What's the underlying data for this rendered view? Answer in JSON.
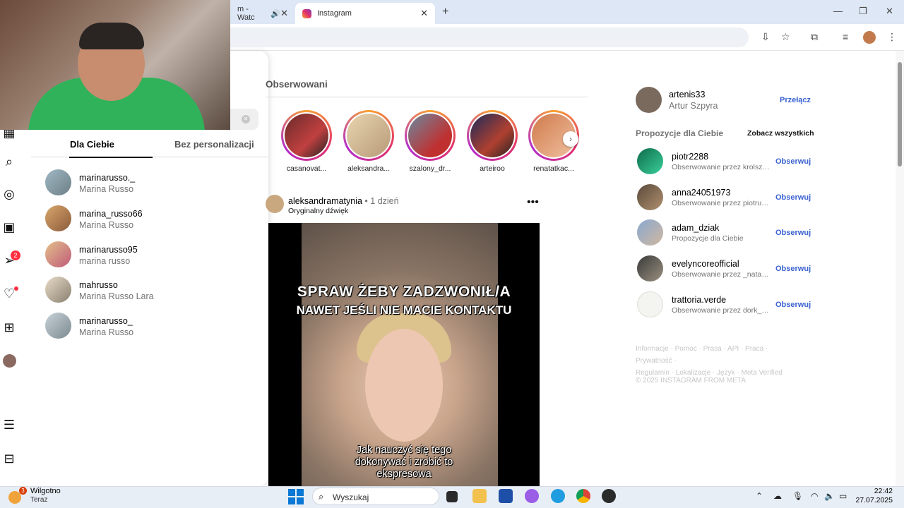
{
  "browser": {
    "tab_prev_title": "m - Watc",
    "tab_active_title": "Instagram",
    "new_tab": "+",
    "close": "✕"
  },
  "search_panel": {
    "tabs": [
      {
        "label": "Dla Ciebie",
        "active": true
      },
      {
        "label": "Bez personalizacji",
        "active": false
      }
    ],
    "results": [
      {
        "username": "marinarusso._",
        "name": "Marina Russo"
      },
      {
        "username": "marina_russo66",
        "name": "Marina Russo"
      },
      {
        "username": "marinarusso95",
        "name": "marina russo"
      },
      {
        "username": "mahrusso",
        "name": "Marina Russo Lara"
      },
      {
        "username": "marinarusso_",
        "name": "Marina Russo"
      }
    ]
  },
  "nav": {
    "messages_badge": "2"
  },
  "feed": {
    "section_title": "Obserwowani",
    "stories": [
      {
        "label": "casanovat..."
      },
      {
        "label": "aleksandra..."
      },
      {
        "label": "szalony_dr..."
      },
      {
        "label": "arteiroo"
      },
      {
        "label": "renatatkac..."
      }
    ],
    "post": {
      "username": "aleksandramatynia",
      "separator": "•",
      "time": "1 dzień",
      "audio": "Oryginalny dźwięk",
      "overlay_line1": "SPRAW ŻEBY ZADZWONIŁ/A",
      "overlay_line2": "NAWET JEŚLI NIE MACIE KONTAKTU",
      "caption_line1": "Jak nauczyć się tego",
      "caption_line2": "dokonywać i zrobić to",
      "caption_line3": "ekspresowa"
    }
  },
  "sidebar": {
    "me": {
      "username": "artenis33",
      "name": "Artur Szpyra",
      "switch_label": "Przełącz"
    },
    "suggestions_title": "Propozycje dla Ciebie",
    "see_all": "Zobacz wszystkich",
    "follow_label": "Obserwuj",
    "suggestions": [
      {
        "username": "piotr2288",
        "subtitle": "Obserwowanie przez krolszo..."
      },
      {
        "username": "anna24051973",
        "subtitle": "Obserwowanie przez piotrus..."
      },
      {
        "username": "adam_dziak",
        "subtitle": "Propozycje dla Ciebie"
      },
      {
        "username": "evelyncoreofficial",
        "subtitle": "Obserwowanie przez _natalia..."
      },
      {
        "username": "trattoria.verde",
        "subtitle": "Obserwowanie przez dork_es..."
      }
    ],
    "footer_line1": "Informacje · Pomoc · Prasa · API · Praca · Prywatność ·",
    "footer_line2": "Regulamin · Lokalizacje · Język · Meta Verified",
    "copyright": "© 2025 INSTAGRAM FROM META"
  },
  "taskbar": {
    "weather_badge": "3",
    "weather_title": "Wilgotno",
    "weather_sub": "Teraz",
    "search_placeholder": "Wyszukaj",
    "time": "22:42",
    "date": "27.07.2025"
  }
}
